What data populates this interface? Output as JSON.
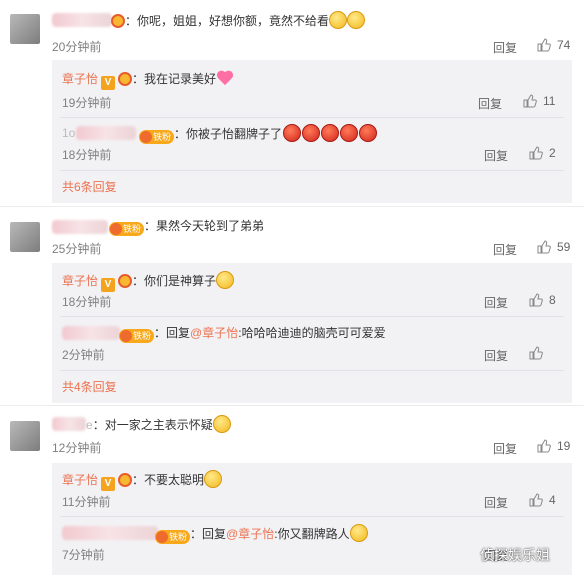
{
  "labels": {
    "reply": "回复",
    "reply_to": "回复"
  },
  "colors": {
    "name": "#eb7350",
    "time": "#808080",
    "reply_box": "#f2f2f5"
  },
  "badges": {
    "fan": "铁粉",
    "verified": "V"
  },
  "thread1": {
    "text": "：你呢，姐姐，好想你额，竟然不给看",
    "time": "20分钟前",
    "likes": "74",
    "reply1": {
      "name": "章子怡",
      "text": "：我在记录美好",
      "time": "19分钟前",
      "likes": "11"
    },
    "reply2": {
      "name_fragment": "1o",
      "text": "：你被子怡翻牌子了",
      "time": "18分钟前",
      "likes": "2"
    },
    "more": "共6条回复"
  },
  "thread2": {
    "text": "：果然今天轮到了弟弟",
    "time": "25分钟前",
    "likes": "59",
    "reply1": {
      "name": "章子怡",
      "text": "：你们是神算子",
      "time": "18分钟前",
      "likes": "8"
    },
    "reply2": {
      "mention": "@章子怡",
      "text": ":哈哈哈迪迪的脑壳可可爱爱",
      "time": "2分钟前"
    },
    "more": "共4条回复"
  },
  "thread3": {
    "name_fragment": "e",
    "text": "：对一家之主表示怀疑",
    "time": "12分钟前",
    "likes": "19",
    "reply1": {
      "name": "章子怡",
      "text": "：不要太聪明",
      "time": "11分钟前",
      "likes": "4"
    },
    "reply2": {
      "mention": "@章子怡",
      "text": ":你又翻牌路人",
      "time": "7分钟前"
    }
  },
  "watermark": "侦探娱乐姐"
}
